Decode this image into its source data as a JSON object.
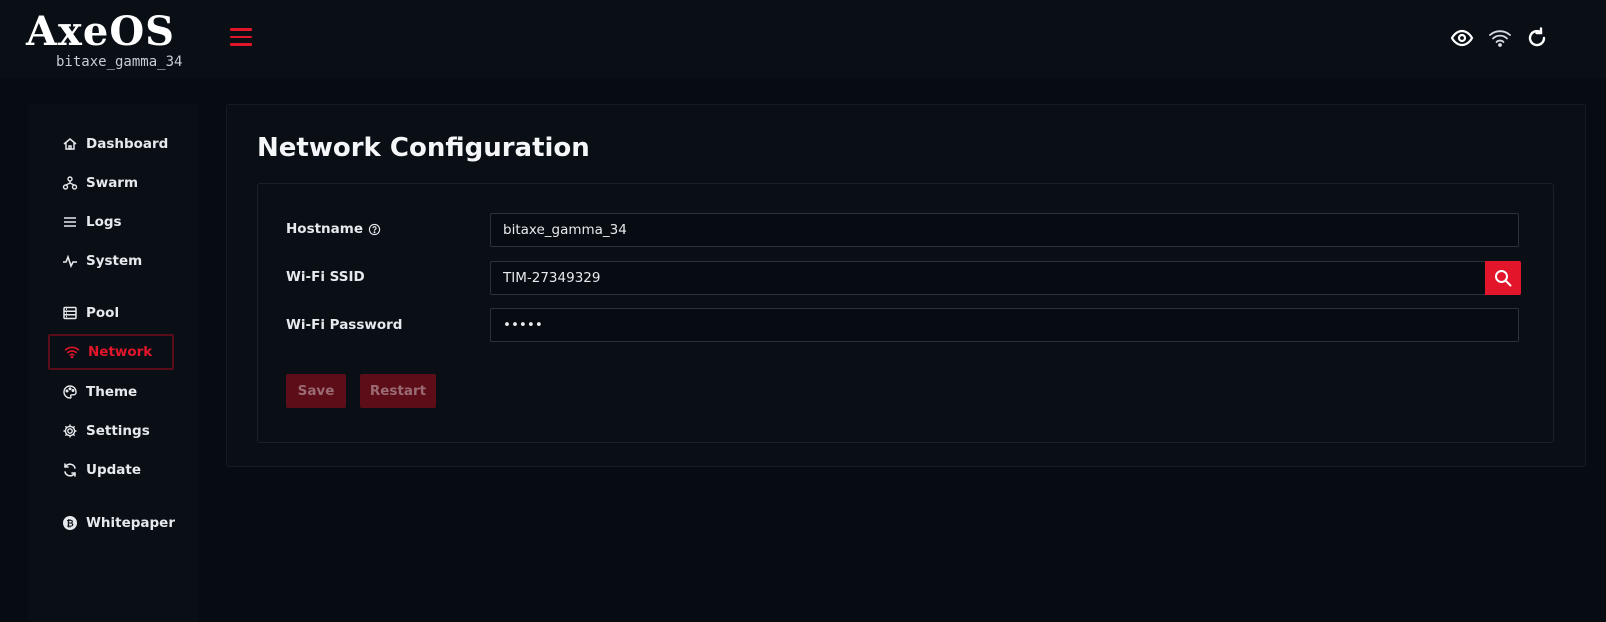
{
  "header": {
    "logo_text": "AxeOS",
    "hostname": "bitaxe_gamma_34",
    "icons": [
      "eye-icon",
      "wifi-icon",
      "refresh-icon"
    ]
  },
  "sidebar": {
    "items": [
      {
        "label": "Dashboard",
        "icon": "home-icon"
      },
      {
        "label": "Swarm",
        "icon": "sitemap-icon"
      },
      {
        "label": "Logs",
        "icon": "list-icon"
      },
      {
        "label": "System",
        "icon": "pulse-icon"
      },
      {
        "label": "Pool",
        "icon": "server-icon"
      },
      {
        "label": "Network",
        "icon": "wifi-icon",
        "active": true
      },
      {
        "label": "Theme",
        "icon": "palette-icon"
      },
      {
        "label": "Settings",
        "icon": "gear-icon"
      },
      {
        "label": "Update",
        "icon": "sync-icon"
      },
      {
        "label": "Whitepaper",
        "icon": "bitcoin-icon"
      }
    ]
  },
  "main": {
    "title": "Network Configuration",
    "fields": {
      "hostname": {
        "label": "Hostname",
        "value": "bitaxe_gamma_34"
      },
      "ssid": {
        "label": "Wi-Fi SSID",
        "value": "TIM-27349329"
      },
      "password": {
        "label": "Wi-Fi Password",
        "value": "•••••"
      }
    },
    "buttons": {
      "save": "Save",
      "restart": "Restart"
    }
  },
  "colors": {
    "accent": "#e3152b",
    "background": "#070b12",
    "panel": "#0a0f16",
    "button_disabled": "#5c0d18"
  }
}
